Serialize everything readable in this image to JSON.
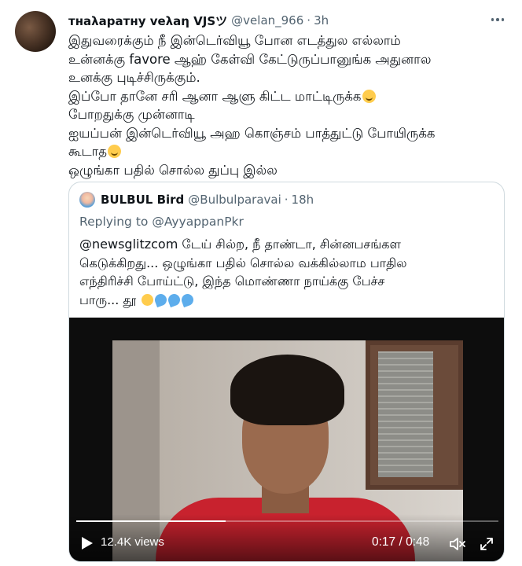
{
  "tweet": {
    "display_name": "тнaλaратну vеλaη VJSツ",
    "handle": "@velan_966",
    "separator": "·",
    "time": "3h",
    "lines": [
      "இதுவரைக்கும் நீ இன்டெர்வியூ போன எடத்துல எல்லாம்",
      "உன்னக்கு favore ஆஹ் கேள்வி கேட்டுருப்பானுங்க அதுனால",
      "உனக்கு புடிச்சிருக்கும்.",
      "இப்போ தானே சரி ஆனா ஆளு கிட்ட மாட்டிருக்க",
      "போறதுக்கு முன்னாடி",
      "ஐயப்பன் இன்டெர்வியூ அஹ கொஞ்சம் பாத்துட்டு போயிருக்க",
      "கூடாத",
      "ஒழுங்கா பதில் சொல்ல துப்பு இல்ல"
    ],
    "emojis": {
      "laughing": "laughing-emoji",
      "grin": "grinning-emoji"
    }
  },
  "quote": {
    "display_name": "BULBUL Bird",
    "handle": "@Bulbulparavai",
    "separator": "·",
    "time": "18h",
    "replying_prefix": "Replying to ",
    "replying_to": "@AyyappanPkr",
    "lines": [
      "@newsglitzcom டேய் சில்ற, நீ தாண்டா, சின்னபசங்கள",
      "கெடுக்கிறது... ஒழுங்கா பதில் சொல்ல வக்கில்லாம பாதில",
      "எந்திரிச்சி போய்ட்டு, இந்த மொண்ணா நாய்க்கு பேச்ச",
      "பாரு... தூ"
    ],
    "video": {
      "views": "12.4K views",
      "time_readout": "0:17 / 0:48",
      "progress": 0.354
    }
  }
}
